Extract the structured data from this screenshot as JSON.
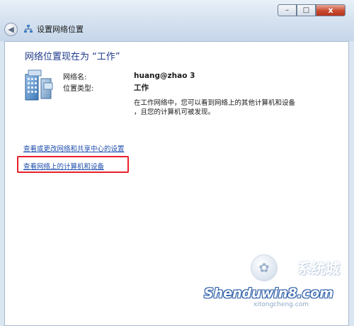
{
  "window": {
    "title": "设置网络位置",
    "controls": {
      "minimize": "–",
      "maximize": "□",
      "close": "x"
    }
  },
  "main": {
    "heading": "网络位置现在为 “工作”",
    "network_name_label": "网络名:",
    "network_name_value": "huang@zhao  3",
    "location_type_label": "位置类型:",
    "location_type_value": "工作",
    "description_line1": "在工作网络中，您可以看到网络上的其他计算机和设备",
    "description_line2": "，且您的计算机可被发现。",
    "link_sharing_center": "查看或更改网络和共享中心的设置",
    "link_view_computers": "查看网络上的计算机和设备"
  },
  "watermark": {
    "site_small": "xitongcheng.com",
    "site_big": "Shenduwin8.com",
    "brand_cn": "系统城"
  },
  "colors": {
    "heading": "#1e3a8a",
    "link": "#1f4fae",
    "highlight_box": "#e8202a",
    "frame": "#dbe6f3"
  }
}
